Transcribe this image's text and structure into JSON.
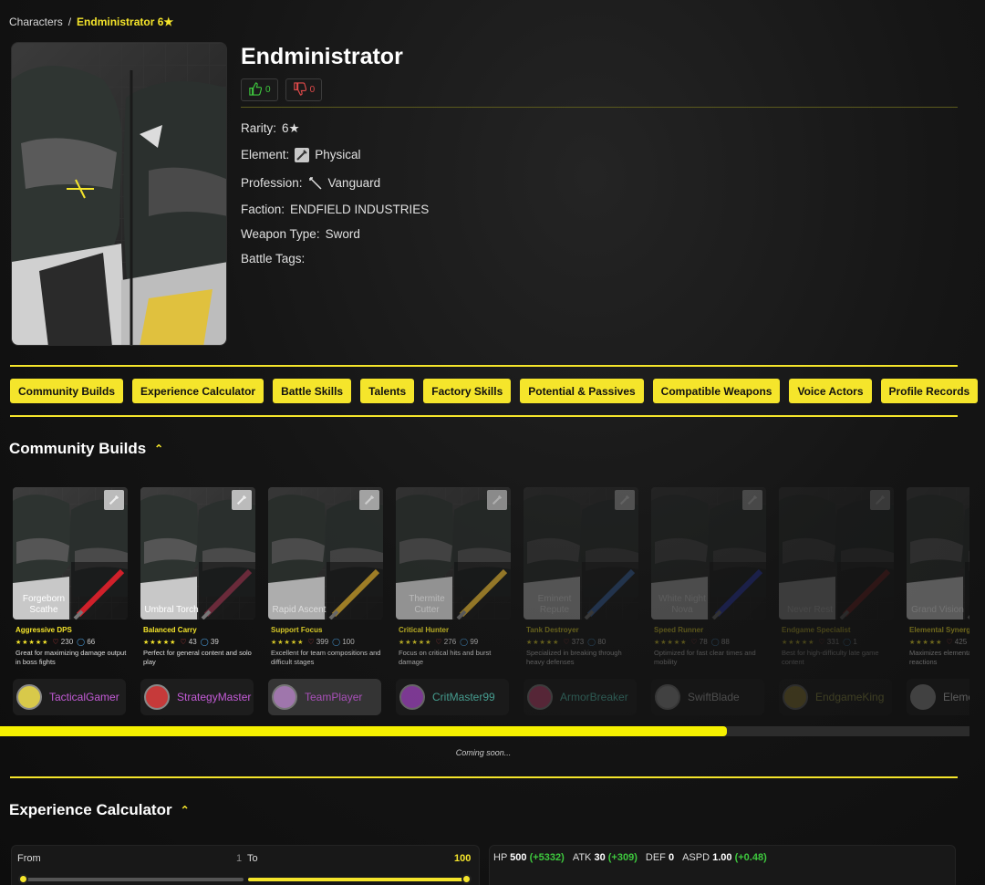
{
  "breadcrumb": {
    "root": "Characters",
    "separator": "/",
    "current": "Endministrator 6★"
  },
  "character": {
    "name": "Endministrator",
    "likes": "0",
    "dislikes": "0",
    "rarity_label": "Rarity:",
    "rarity": "6★",
    "element_label": "Element:",
    "element": "Physical",
    "profession_label": "Profession:",
    "profession": "Vanguard",
    "faction_label": "Faction:",
    "faction": "ENDFIELD INDUSTRIES",
    "weapon_type_label": "Weapon Type:",
    "weapon_type": "Sword",
    "battle_tags_label": "Battle Tags:"
  },
  "tabs": [
    "Community Builds",
    "Experience Calculator",
    "Battle Skills",
    "Talents",
    "Factory Skills",
    "Potential & Passives",
    "Compatible Weapons",
    "Voice Actors",
    "Profile Records"
  ],
  "community_builds": {
    "title": "Community Builds",
    "coming_soon": "Coming soon...",
    "scroll_progress": 0.75,
    "builds": [
      {
        "weapon": "Forgeborn Scathe",
        "role": "Aggressive DPS",
        "rating": "★★★★★",
        "likes": "230",
        "comments": "66",
        "desc": "Great for maximizing damage output in boss fights",
        "author": "TacticalGamer",
        "weapon_color": "#d0202a",
        "avatar_color": "#d8c94a",
        "author_color": "#c35bd6",
        "opacity": 1
      },
      {
        "weapon": "Umbral Torch",
        "role": "Balanced Carry",
        "rating": "★★★★★",
        "likes": "43",
        "comments": "39",
        "desc": "Perfect for general content and solo play",
        "author": "StrategyMaster",
        "weapon_color": "#6a2a3a",
        "avatar_color": "#c63a3a",
        "author_color": "#c35bd6",
        "opacity": 1
      },
      {
        "weapon": "Rapid Ascent",
        "role": "Support Focus",
        "rating": "★★★★★",
        "likes": "399",
        "comments": "100",
        "desc": "Excellent for team compositions and difficult stages",
        "author": "TeamPlayer",
        "weapon_color": "#b6902a",
        "avatar_color": "#b888c8",
        "author_color": "#c35bd6",
        "opacity": 0.85
      },
      {
        "weapon": "Thermite Cutter",
        "role": "Critical Hunter",
        "rating": "★★★★★",
        "likes": "276",
        "comments": "99",
        "desc": "Focus on critical hits and burst damage",
        "author": "CritMaster99",
        "weapon_color": "#c8a030",
        "avatar_color": "#a84ac8",
        "author_color": "#5bd6c3",
        "opacity": 0.7
      },
      {
        "weapon": "Eminent Repute",
        "role": "Tank Destroyer",
        "rating": "★★★★★",
        "likes": "373",
        "comments": "80",
        "desc": "Specialized in breaking through heavy defenses",
        "author": "ArmorBreaker",
        "weapon_color": "#3a6ab0",
        "avatar_color": "#d04a7a",
        "author_color": "#5bd6c3",
        "opacity": 0.35
      },
      {
        "weapon": "White Night Nova",
        "role": "Speed Runner",
        "rating": "★★★★★",
        "likes": "78",
        "comments": "88",
        "desc": "Optimized for fast clear times and mobility",
        "author": "SwiftBlade",
        "weapon_color": "#2a3ac0",
        "avatar_color": "#aaaaaa",
        "author_color": "#cccccc",
        "opacity": 0.3
      },
      {
        "weapon": "Never Rest",
        "role": "Endgame Specialist",
        "rating": "★★★★★",
        "likes": "331",
        "comments": "1",
        "desc": "Best for high-difficulty late game content",
        "author": "EndgameKing",
        "weapon_color": "#8a2020",
        "avatar_color": "#c8b040",
        "author_color": "#d6d65b",
        "opacity": 0.22
      },
      {
        "weapon": "Grand Vision",
        "role": "Elemental Synergy",
        "rating": "★★★★★",
        "likes": "425",
        "comments": "",
        "desc": "Maximizes elemental effects and reactions",
        "author": "ElementalMage",
        "weapon_color": "#444444",
        "avatar_color": "#888888",
        "author_color": "#cccccc",
        "opacity": 0.4
      }
    ]
  },
  "experience_calculator": {
    "title": "Experience Calculator",
    "from_label": "From",
    "from_value": "1",
    "to_label": "To",
    "to_value": "100",
    "stats": [
      {
        "name": "HP",
        "value": "500",
        "bonus": "(+5332)"
      },
      {
        "name": "ATK",
        "value": "30",
        "bonus": "(+309)"
      },
      {
        "name": "DEF",
        "value": "0",
        "bonus": ""
      },
      {
        "name": "ASPD",
        "value": "1.00",
        "bonus": "(+0.48)"
      }
    ]
  },
  "colors": {
    "accent": "#f5e52b",
    "like": "#3ec83e",
    "dislike": "#e24a4a"
  }
}
